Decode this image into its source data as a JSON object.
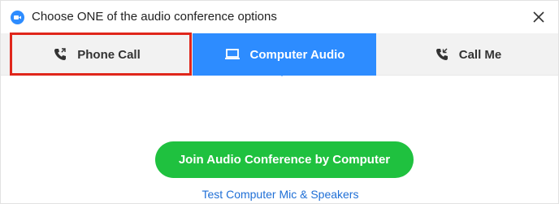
{
  "window": {
    "title": "Choose ONE of the audio conference options",
    "app_icon": "zoom-camera-icon",
    "close_icon": "close-icon"
  },
  "tabs": [
    {
      "label": "Phone Call",
      "icon": "phone-icon",
      "selected": false,
      "highlighted": true
    },
    {
      "label": "Computer Audio",
      "icon": "laptop-icon",
      "selected": true
    },
    {
      "label": "Call Me",
      "icon": "phone-icon",
      "selected": false
    }
  ],
  "main": {
    "join_button_label": "Join Audio Conference by Computer",
    "test_link_label": "Test Computer Mic & Speakers"
  },
  "colors": {
    "accent": "#2d8cff",
    "join_button": "#1fc13f",
    "highlight_box": "#e0261b",
    "link": "#1f6fd6"
  }
}
